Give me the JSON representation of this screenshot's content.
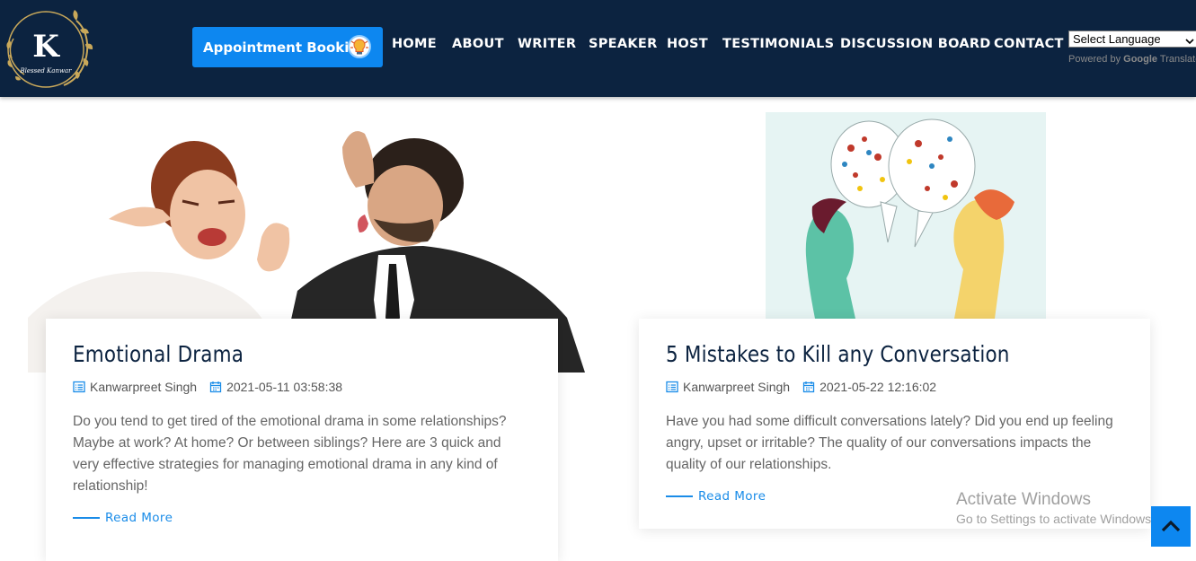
{
  "header": {
    "logo_text": "Blessed Kanwar",
    "logo_letter": "K",
    "appointment_button": "Appointment Booking",
    "nav": [
      "HOME",
      "ABOUT",
      "WRITER",
      "SPEAKER",
      "HOST",
      "TESTIMONIALS",
      "DISCUSSION BOARD",
      "CONTACT"
    ],
    "language_select": "Select Language",
    "powered_by": "Powered by",
    "google": "Google",
    "translate": "Translate",
    "colors": {
      "header_bg": "#0c2340",
      "accent": "#0d87f0"
    }
  },
  "posts": [
    {
      "image_icon": "couple-arguing-photo",
      "title": "Emotional Drama",
      "author": "Kanwarpreet Singh",
      "date": "2021-05-11 03:58:38",
      "excerpt": "Do you tend to get tired of the emotional drama in some relationships? Maybe at work? At home? Or between siblings? Here are 3 quick and very effective strategies for managing emotional drama in any kind of relationship!",
      "read_more": "Read More"
    },
    {
      "image_icon": "conversation-illustration",
      "title": "5 Mistakes to Kill any Conversation",
      "author": "Kanwarpreet Singh",
      "date": "2021-05-22 12:16:02",
      "excerpt": "Have you had some difficult conversations lately? Did you end up feeling angry, upset or irritable? The quality of our conversations impacts the quality of our relationships.",
      "read_more": "Read More"
    }
  ],
  "watermark": {
    "title": "Activate Windows",
    "subtitle": "Go to Settings to activate Windows."
  }
}
